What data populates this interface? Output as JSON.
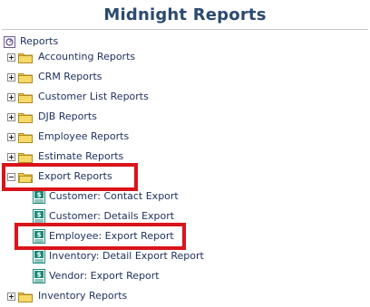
{
  "header": {
    "title": "Midnight Reports"
  },
  "tree": {
    "root_label": "Reports",
    "folders": [
      {
        "label": "Accounting Reports",
        "expanded": false
      },
      {
        "label": "CRM Reports",
        "expanded": false
      },
      {
        "label": "Customer List Reports",
        "expanded": false
      },
      {
        "label": "DJB Reports",
        "expanded": false
      },
      {
        "label": "Employee Reports",
        "expanded": false
      },
      {
        "label": "Estimate Reports",
        "expanded": false
      },
      {
        "label": "Export Reports",
        "expanded": true,
        "highlighted": true
      },
      {
        "label": "Inventory Reports",
        "expanded": false
      }
    ],
    "export_reports_children": [
      {
        "label": "Customer: Contact Export",
        "icon": "report-icon"
      },
      {
        "label": "Customer: Details Export",
        "icon": "report-icon"
      },
      {
        "label": "Employee: Export Report",
        "icon": "report-icon",
        "highlighted": true
      },
      {
        "label": "Inventory: Detail Export Report",
        "icon": "report-icon"
      },
      {
        "label": "Vendor: Export Report",
        "icon": "report-icon"
      }
    ]
  },
  "colors": {
    "title": "#2b4a6f",
    "link_text": "#1d2f5e",
    "highlight": "#d9141a",
    "folder": "#f2c94c",
    "report_icon": "#1f8a7a"
  }
}
